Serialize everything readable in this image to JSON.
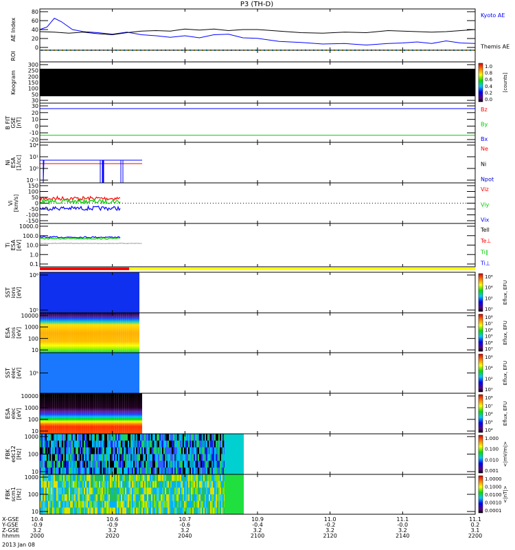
{
  "title": "P3 (TH-D)",
  "date_label": "2013 Jan 08",
  "chart_data": {
    "type": "line",
    "x_range_hhmm": [
      "2000",
      "2200"
    ],
    "x_minutes": [
      0,
      120
    ],
    "orbit_rows": [
      {
        "label": "X-GSE",
        "values": [
          "10.4",
          "10.6",
          "10.7",
          "10.9",
          "11.0",
          "11.1",
          "11.1"
        ]
      },
      {
        "label": "Y-GSE",
        "values": [
          "-0.9",
          "-0.9",
          "-0.6",
          "-0.4",
          "-0.2",
          "-0.0",
          "0.2"
        ]
      },
      {
        "label": "Z-GSE",
        "values": [
          "3.2",
          "3.2",
          "3.2",
          "3.2",
          "3.2",
          "3.2",
          "3.1"
        ]
      },
      {
        "label": "hhmm",
        "values": [
          "2000",
          "2020",
          "2040",
          "2100",
          "2120",
          "2140",
          "2200"
        ]
      }
    ],
    "panels": [
      {
        "id": "ae",
        "ylabel": [
          "AE Index"
        ],
        "ylim": [
          0,
          80
        ],
        "ticks": [
          "80",
          "60",
          "40",
          "20",
          "0"
        ],
        "legend": [
          {
            "text": "Kyoto AE",
            "color": "#0000ff"
          },
          {
            "text": "Themis AE",
            "color": "#000000"
          }
        ],
        "series": [
          {
            "name": "Kyoto AE",
            "color": "#0000ff",
            "x": [
              0,
              2,
              4,
              6,
              9,
              12,
              16,
              20,
              24,
              28,
              32,
              36,
              40,
              44,
              48,
              52,
              56,
              60,
              66,
              72,
              78,
              84,
              90,
              96,
              100,
              104,
              108,
              112,
              116,
              120
            ],
            "y": [
              40,
              45,
              62,
              55,
              40,
              36,
              34,
              31,
              35,
              30,
              28,
              25,
              28,
              24,
              30,
              31,
              24,
              23,
              17,
              15,
              12,
              13,
              10,
              13,
              14,
              16,
              13,
              18,
              14,
              13
            ]
          },
          {
            "name": "Themis AE",
            "color": "#000000",
            "x": [
              0,
              4,
              8,
              12,
              16,
              20,
              24,
              28,
              32,
              36,
              40,
              44,
              48,
              52,
              56,
              60,
              66,
              72,
              78,
              84,
              90,
              96,
              100,
              104,
              108,
              112,
              116,
              120
            ],
            "y": [
              36,
              35,
              33,
              35,
              32,
              30,
              34,
              37,
              38,
              37,
              41,
              39,
              41,
              38,
              40,
              40,
              37,
              34,
              33,
              35,
              34,
              38,
              37,
              36,
              35,
              36,
              38,
              40
            ]
          }
        ]
      },
      {
        "id": "roi",
        "ylabel": [
          "ROI"
        ],
        "ticks": []
      },
      {
        "id": "keogram",
        "ylabel": [
          "Keogram"
        ],
        "ticks": [
          "300",
          "250",
          "200",
          "150",
          "100",
          "50",
          "30"
        ],
        "colorbar": {
          "ticks": [
            "1.0",
            "0.8",
            "0.6",
            "0.4",
            "0.2",
            "0.0"
          ],
          "unit": "[counts]"
        }
      },
      {
        "id": "bfit",
        "ylabel": [
          "B FIT",
          "GSE",
          "[nT]"
        ],
        "ylim": [
          -20,
          30
        ],
        "ticks": [
          "30",
          "20",
          "10",
          "0",
          "-10",
          "-20"
        ],
        "legend": [
          {
            "text": "Bz",
            "color": "#ff0000"
          },
          {
            "text": "By",
            "color": "#00cc00"
          },
          {
            "text": "Bx",
            "color": "#0000ff"
          }
        ],
        "levels": [
          {
            "name": "Bx",
            "color": "#0000ff",
            "value": 23
          },
          {
            "name": "By",
            "color": "#00cc00",
            "value": -11
          }
        ]
      },
      {
        "id": "ni",
        "ylabel": [
          "Ni",
          "ESA",
          "[1/cc]"
        ],
        "ticks": [
          "10⁴",
          "10¹",
          "10⁰",
          "10⁻¹"
        ],
        "legend": [
          {
            "text": "Ne",
            "color": "#ff0000"
          },
          {
            "text": "Ni",
            "color": "#000000"
          },
          {
            "text": "Npot",
            "color": "#0000cc"
          }
        ]
      },
      {
        "id": "vi",
        "ylabel": [
          "Vi",
          "[km/s]"
        ],
        "ylim": [
          -150,
          150
        ],
        "ticks": [
          "150",
          "100",
          "50",
          "0",
          "-50",
          "-100",
          "-150"
        ],
        "legend": [
          {
            "text": "Viz",
            "color": "#ff0000"
          },
          {
            "text": "Viy",
            "color": "#00cc00"
          },
          {
            "text": "Vix",
            "color": "#0000ff"
          }
        ],
        "series_means": [
          {
            "name": "Viz",
            "color": "#ff0000",
            "value": 35
          },
          {
            "name": "Viy",
            "color": "#00cc00",
            "value": 12
          },
          {
            "name": "Vix",
            "color": "#0000ff",
            "value": -38
          }
        ]
      },
      {
        "id": "ti",
        "ylabel": [
          "Ti",
          "ESA",
          "[eV]"
        ],
        "ticks": [
          "1000.0",
          "100.0",
          "10.0",
          "1.0",
          "0.1"
        ],
        "legend": [
          {
            "text": "Tell",
            "color": "#000000"
          },
          {
            "text": "Te⊥",
            "color": "#ff0000"
          },
          {
            "text": "Ti∥",
            "color": "#00cc00"
          },
          {
            "text": "Ti⊥",
            "color": "#0000ff"
          }
        ]
      },
      {
        "id": "sst_i",
        "ylabel": [
          "SST",
          "ions",
          "[eV]"
        ],
        "ticks": [
          "10⁶",
          "10⁵"
        ],
        "colorbar": {
          "ticks": [
            "10⁶",
            "10⁴",
            "10²",
            "10⁰"
          ],
          "unit": "Eflux, EFU"
        }
      },
      {
        "id": "esa_i",
        "ylabel": [
          "ESA",
          "ions",
          "[eV]"
        ],
        "ticks": [
          "10000",
          "1000",
          "100",
          "10"
        ],
        "colorbar": {
          "ticks": [
            "10⁸",
            "10⁷",
            "10⁶",
            "10⁵",
            "10⁴",
            "10³"
          ],
          "unit": "Eflux, EFU"
        }
      },
      {
        "id": "sst_e",
        "ylabel": [
          "SST",
          "elec",
          "[eV]"
        ],
        "ticks": [
          "10⁵"
        ],
        "colorbar": {
          "ticks": [
            "10⁶",
            "10⁴",
            "10²",
            "10⁰"
          ],
          "unit": "Eflux, EFU"
        }
      },
      {
        "id": "esa_e",
        "ylabel": [
          "ESA",
          "elec",
          "[eV]"
        ],
        "ticks": [
          "10000",
          "1000",
          "100",
          "10"
        ],
        "colorbar": {
          "ticks": [
            "10⁸",
            "10⁷",
            "10⁶",
            "10⁵",
            "10⁴"
          ],
          "unit": "Eflux, EFU"
        }
      },
      {
        "id": "fbk_e",
        "ylabel": [
          "FBK",
          "edc12",
          "[Hz]"
        ],
        "ticks": [
          "1000",
          "100",
          "10"
        ],
        "colorbar": {
          "ticks": [
            "1.000",
            "0.100",
            "0.010",
            "0.001"
          ],
          "unit": "<|mV/m|>"
        }
      },
      {
        "id": "fbk_b",
        "ylabel": [
          "FBK",
          "scm1",
          "[Hz]"
        ],
        "ticks": [
          "1000",
          "100",
          "10"
        ],
        "colorbar": {
          "ticks": [
            "1.0000",
            "0.1000",
            "0.0100",
            "0.0010",
            "0.0001"
          ],
          "unit": "<|nT|>"
        }
      }
    ]
  }
}
